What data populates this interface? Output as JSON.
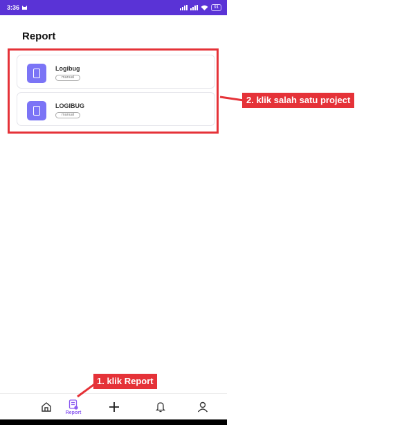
{
  "status_bar": {
    "time": "3:36",
    "battery": "91"
  },
  "header": {
    "title": "Report"
  },
  "projects": [
    {
      "name": "Logibug",
      "badge": "manual"
    },
    {
      "name": "LOGIBUG",
      "badge": "manual"
    }
  ],
  "nav": {
    "report_label": "Report"
  },
  "annotations": {
    "step1": "1. klik Report",
    "step2": "2. klik salah satu project"
  },
  "colors": {
    "accent": "#5a33d6",
    "project_icon": "#7b74f6",
    "annotation": "#e53238",
    "nav_active": "#8c5cf0"
  },
  "icons": [
    "cat-icon",
    "signal-icon",
    "wifi-icon",
    "battery-icon",
    "phone-icon",
    "home-icon",
    "report-icon",
    "plus-icon",
    "bell-icon",
    "user-icon"
  ]
}
